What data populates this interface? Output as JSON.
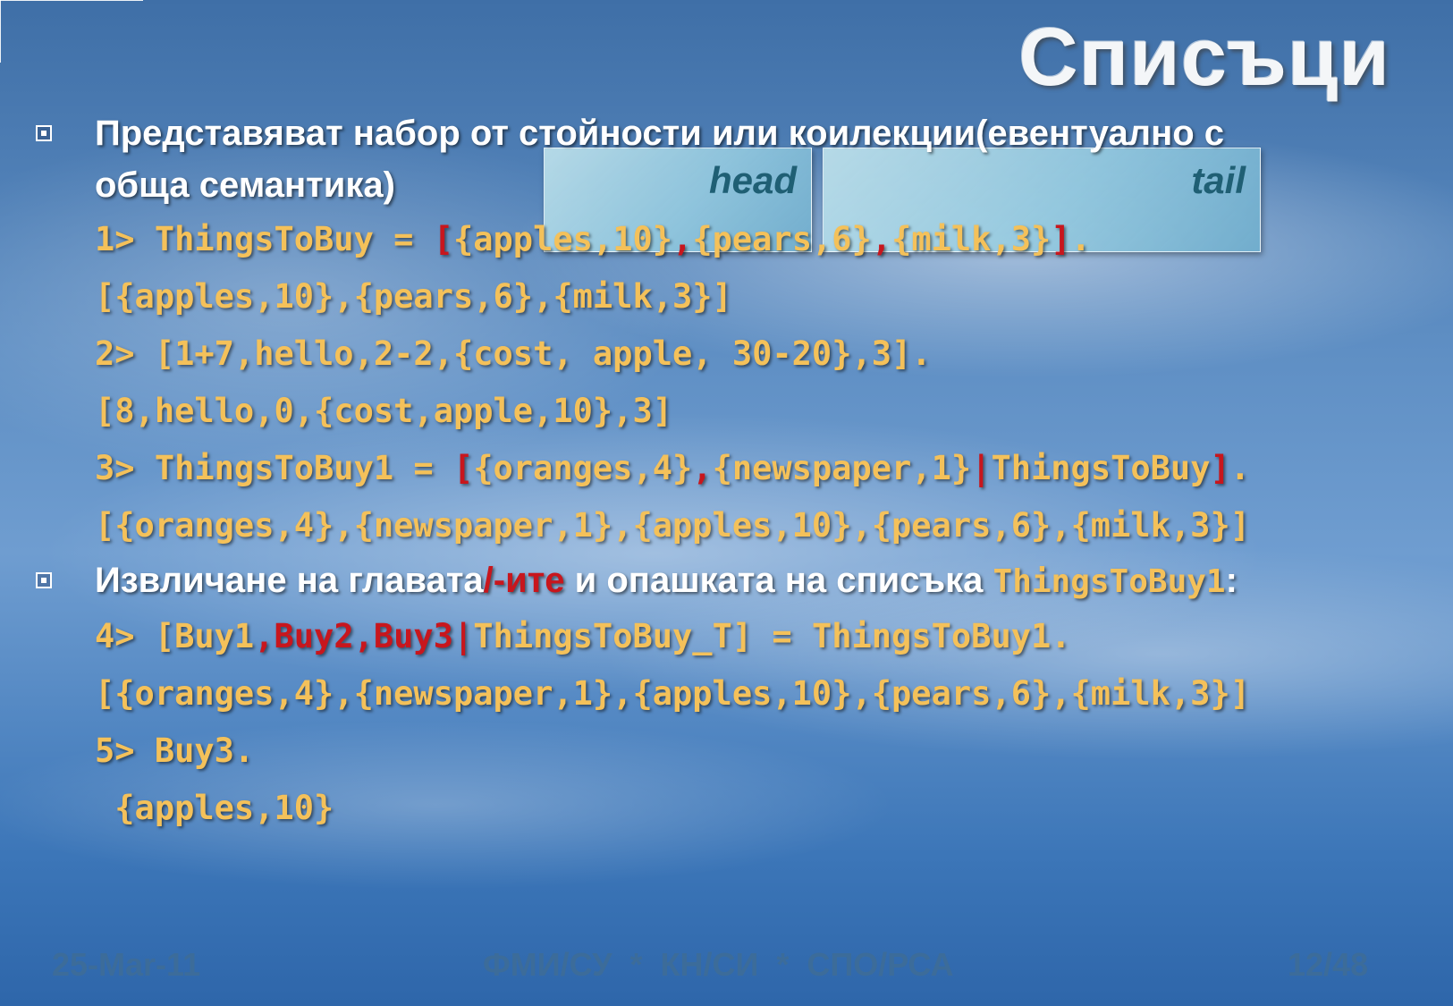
{
  "slide": {
    "title": "Списъци",
    "bullet1": {
      "line1": "Представяват набор от стойности или коилекции(евентуално с",
      "line2": "обща семантика)"
    },
    "overlay": {
      "head": "head",
      "tail": "tail"
    },
    "code1": {
      "prompt": "1> ThingsToBuy = ",
      "p_open": "[",
      "a": "{apples,10}",
      "c1": ",",
      "b": "{pears,6}",
      "c2": ",",
      "c": "{milk,3}",
      "p_close": "]",
      "end": "."
    },
    "result1": "[{apples,10},{pears,6},{milk,3}]",
    "code2": "2> [1+7,hello,2-2,{cost, apple, 30-20},3].",
    "result2": "[8,hello,0,{cost,apple,10},3]",
    "code3": {
      "prompt": "3> ThingsToBuy1 = ",
      "p_open": "[",
      "a": "{oranges,4}",
      "c1": ",",
      "b": "{newspaper,1}",
      "bar": "|",
      "rest": "ThingsToBuy",
      "p_close": "]",
      "end": "."
    },
    "result3": "[{oranges,4},{newspaper,1},{apples,10},{pears,6},{milk,3}]",
    "bullet2": {
      "pre": "Извличане на главата",
      "red": "/-ите",
      "mid": " и опашката на списъка ",
      "var": "ThingsToBuy1",
      "end": ":"
    },
    "code4": {
      "prompt": "4> [Buy1",
      "red": ",Buy2,Buy3",
      "bar": "|",
      "rest": "ThingsToBuy_T] = ThingsToBuy1."
    },
    "result4": "[{oranges,4},{newspaper,1},{apples,10},{pears,6},{milk,3}]",
    "code5": "5> Buy3.",
    "result5": " {apples,10}"
  },
  "footer": {
    "date": "25-Mar-11",
    "center": "ФМИ/СУ  *  КН/СИ  *  СПО/РСА",
    "page": "12/48"
  }
}
